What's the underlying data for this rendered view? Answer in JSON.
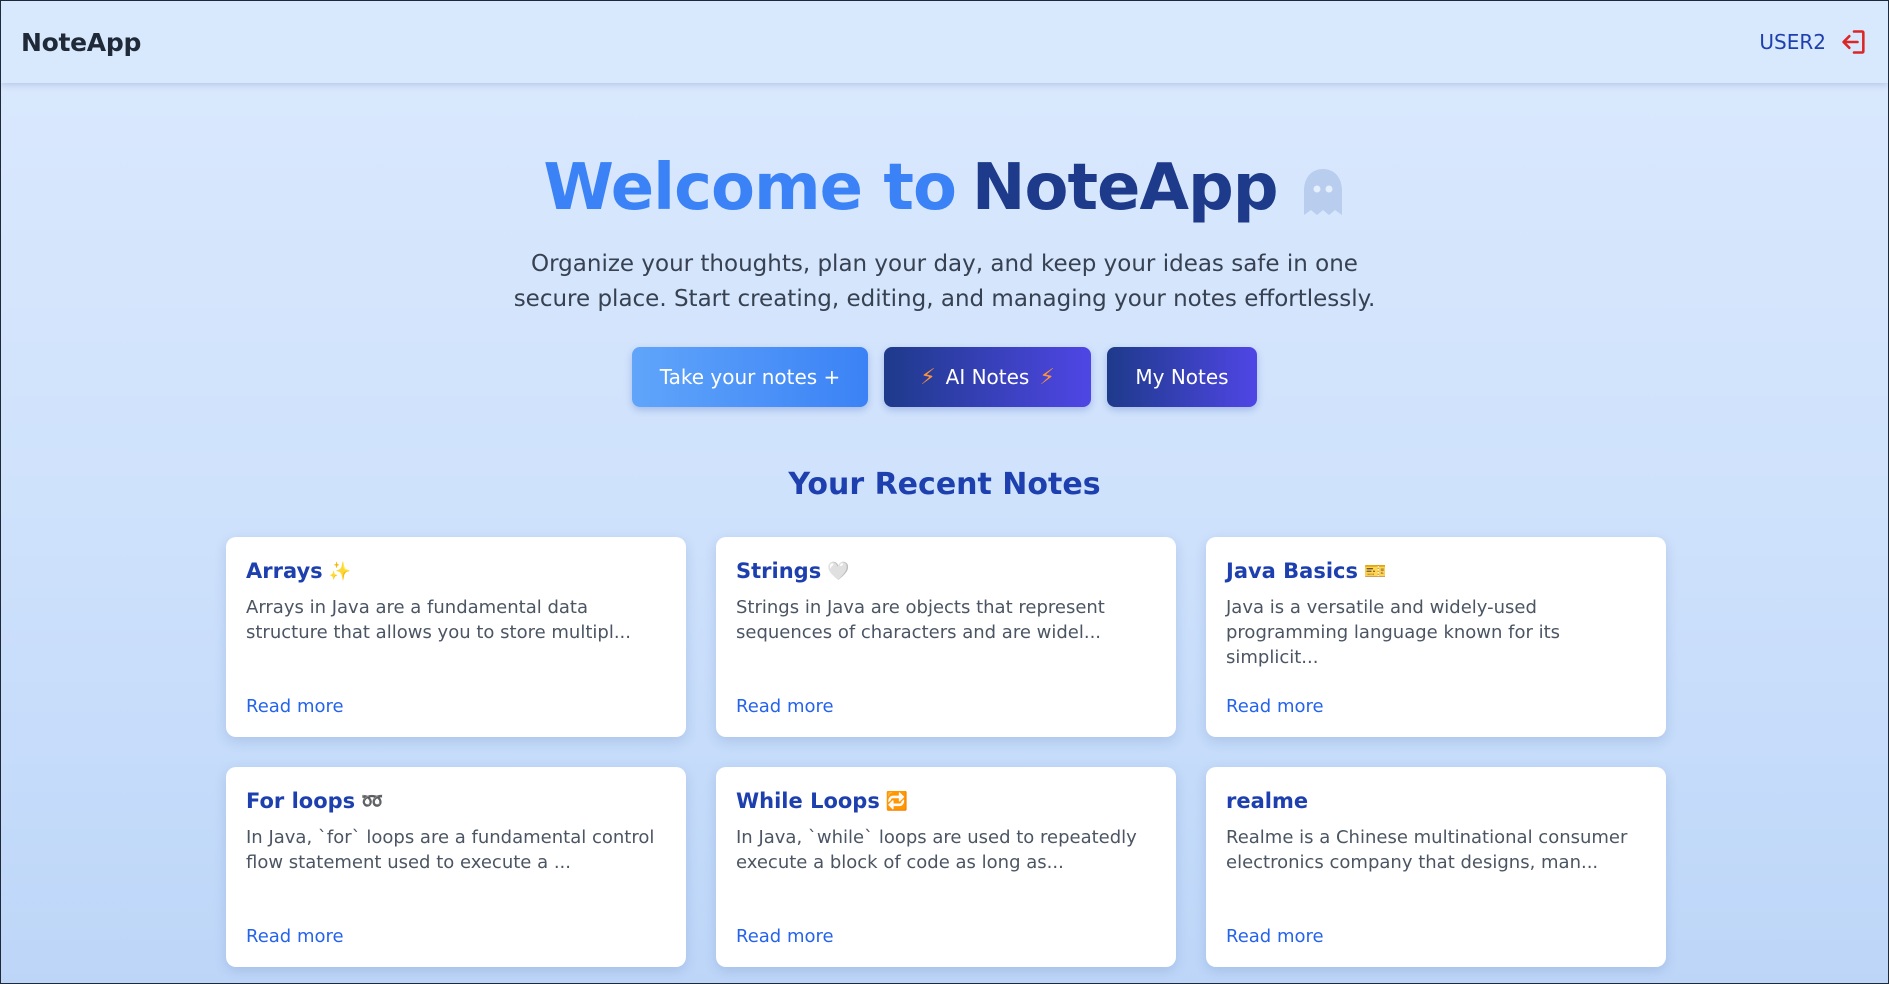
{
  "navbar": {
    "brand": "NoteApp",
    "username": "USER2",
    "logout_icon": "logout-icon"
  },
  "hero": {
    "title_part1": "Welcome to",
    "title_part2": "NoteApp",
    "title_icon": "ghost-icon",
    "subtitle": "Organize your thoughts, plan your day, and keep your ideas safe in one secure place. Start creating, editing, and managing your notes effortlessly."
  },
  "actions": {
    "take_notes": "Take your notes +",
    "ai_notes": "AI Notes",
    "my_notes": "My Notes"
  },
  "recent": {
    "title": "Your Recent Notes",
    "read_more": "Read more",
    "notes": [
      {
        "title": "Arrays",
        "emoji": "✨",
        "excerpt": "Arrays in Java are a fundamental data structure that allows you to store multipl..."
      },
      {
        "title": "Strings",
        "emoji": "🤍",
        "excerpt": "Strings in Java are objects that represent sequences of characters and are widel..."
      },
      {
        "title": "Java Basics",
        "emoji": "🎫",
        "excerpt": "Java is a versatile and widely-used programming language known for its simplicit..."
      },
      {
        "title": "For loops",
        "emoji": "➿",
        "excerpt": "In Java, `for` loops are a fundamental control flow statement used to execute a ..."
      },
      {
        "title": "While Loops",
        "emoji": "🔁",
        "excerpt": "In Java, `while` loops are used to repeatedly execute a block of code as long as..."
      },
      {
        "title": "realme",
        "emoji": "",
        "excerpt": "Realme is a Chinese multinational consumer electronics company that designs, man..."
      }
    ]
  },
  "colors": {
    "accent_light": "#3b82f6",
    "accent_dark": "#1e3a8a",
    "logout": "#dc2626",
    "bolt": "#fb923c"
  }
}
